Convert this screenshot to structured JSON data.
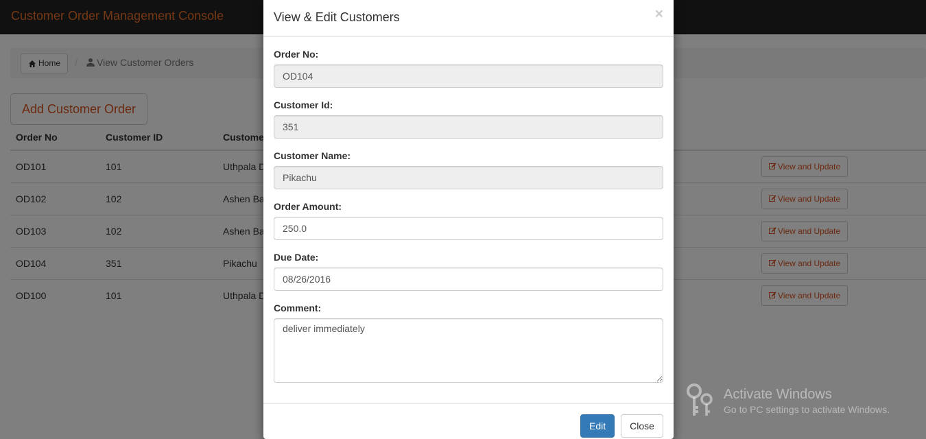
{
  "app": {
    "title": "Customer Order Management Console"
  },
  "breadcrumb": {
    "home_label": "Home",
    "separator": "/",
    "current_label": "View Customer Orders"
  },
  "actions": {
    "add_label": "Add Customer Order"
  },
  "table": {
    "headers": [
      "Order No",
      "Customer ID",
      "Customer Name"
    ],
    "rows": [
      {
        "order_no": "OD101",
        "customer_id": "101",
        "customer_name": "Uthpala D",
        "action": "View and Update"
      },
      {
        "order_no": "OD102",
        "customer_id": "102",
        "customer_name": "Ashen Ba",
        "action": "View and Update"
      },
      {
        "order_no": "OD103",
        "customer_id": "102",
        "customer_name": "Ashen Ba",
        "action": "View and Update"
      },
      {
        "order_no": "OD104",
        "customer_id": "351",
        "customer_name": "Pikachu",
        "action": "View and Update"
      },
      {
        "order_no": "OD100",
        "customer_id": "101",
        "customer_name": "Uthpala D",
        "action": "View and Update"
      }
    ]
  },
  "modal": {
    "title": "View & Edit Customers",
    "close_glyph": "×",
    "fields": {
      "order_no": {
        "label": "Order No:",
        "value": "OD104"
      },
      "customer_id": {
        "label": "Customer Id:",
        "value": "351"
      },
      "customer_name": {
        "label": "Customer Name:",
        "value": "Pikachu"
      },
      "order_amount": {
        "label": "Order Amount:",
        "value": "250.0"
      },
      "due_date": {
        "label": "Due Date:",
        "value": "08/26/2016"
      },
      "comment": {
        "label": "Comment:",
        "value": "deliver immediately"
      }
    },
    "edit_label": "Edit",
    "close_label": "Close"
  },
  "watermark": {
    "title": "Activate Windows",
    "subtitle": "Go to PC settings to activate Windows."
  },
  "colors": {
    "brand": "#e8702a",
    "accent": "#d9531e",
    "primary": "#337ab7",
    "navbar": "#222222"
  },
  "icons": {
    "home": "home-icon",
    "user": "user-icon",
    "edit": "edit-icon",
    "close": "close-icon",
    "key": "key-icon"
  }
}
